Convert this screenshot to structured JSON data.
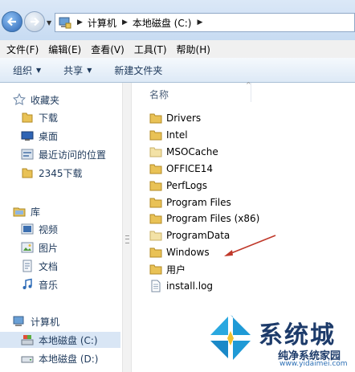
{
  "window": {
    "breadcrumb": [
      "计算机",
      "本地磁盘 (C:)"
    ],
    "accent": "#2a63b3"
  },
  "menu": [
    "文件(F)",
    "编辑(E)",
    "查看(V)",
    "工具(T)",
    "帮助(H)"
  ],
  "toolbar": {
    "organize": "组织",
    "share": "共享",
    "new_folder": "新建文件夹"
  },
  "sidebar": {
    "favorites_label": "收藏夹",
    "favorites": [
      {
        "label": "下载",
        "icon": "folder-icon"
      },
      {
        "label": "桌面",
        "icon": "desktop-icon"
      },
      {
        "label": "最近访问的位置",
        "icon": "recent-places-icon"
      },
      {
        "label": "2345下载",
        "icon": "folder-icon"
      }
    ],
    "libraries_label": "库",
    "libraries": [
      {
        "label": "视频",
        "icon": "video-library-icon"
      },
      {
        "label": "图片",
        "icon": "pictures-library-icon"
      },
      {
        "label": "文档",
        "icon": "documents-library-icon"
      },
      {
        "label": "音乐",
        "icon": "music-library-icon"
      }
    ],
    "computer_label": "计算机",
    "drives": [
      {
        "label": "本地磁盘 (C:)",
        "icon": "drive-c-icon",
        "selected": true
      },
      {
        "label": "本地磁盘 (D:)",
        "icon": "drive-d-icon",
        "selected": false
      }
    ]
  },
  "filelist": {
    "column_name": "名称",
    "items": [
      {
        "name": "Drivers",
        "type": "folder"
      },
      {
        "name": "Intel",
        "type": "folder"
      },
      {
        "name": "MSOCache",
        "type": "folder-light"
      },
      {
        "name": "OFFICE14",
        "type": "folder"
      },
      {
        "name": "PerfLogs",
        "type": "folder"
      },
      {
        "name": "Program Files",
        "type": "folder"
      },
      {
        "name": "Program Files (x86)",
        "type": "folder"
      },
      {
        "name": "ProgramData",
        "type": "folder-light"
      },
      {
        "name": "Windows",
        "type": "folder"
      },
      {
        "name": "用户",
        "type": "folder"
      },
      {
        "name": "install.log",
        "type": "file"
      }
    ]
  },
  "watermark": {
    "title": "系统城",
    "subtitle": "纯净系统家园",
    "url": "www.yidaimei.com"
  }
}
